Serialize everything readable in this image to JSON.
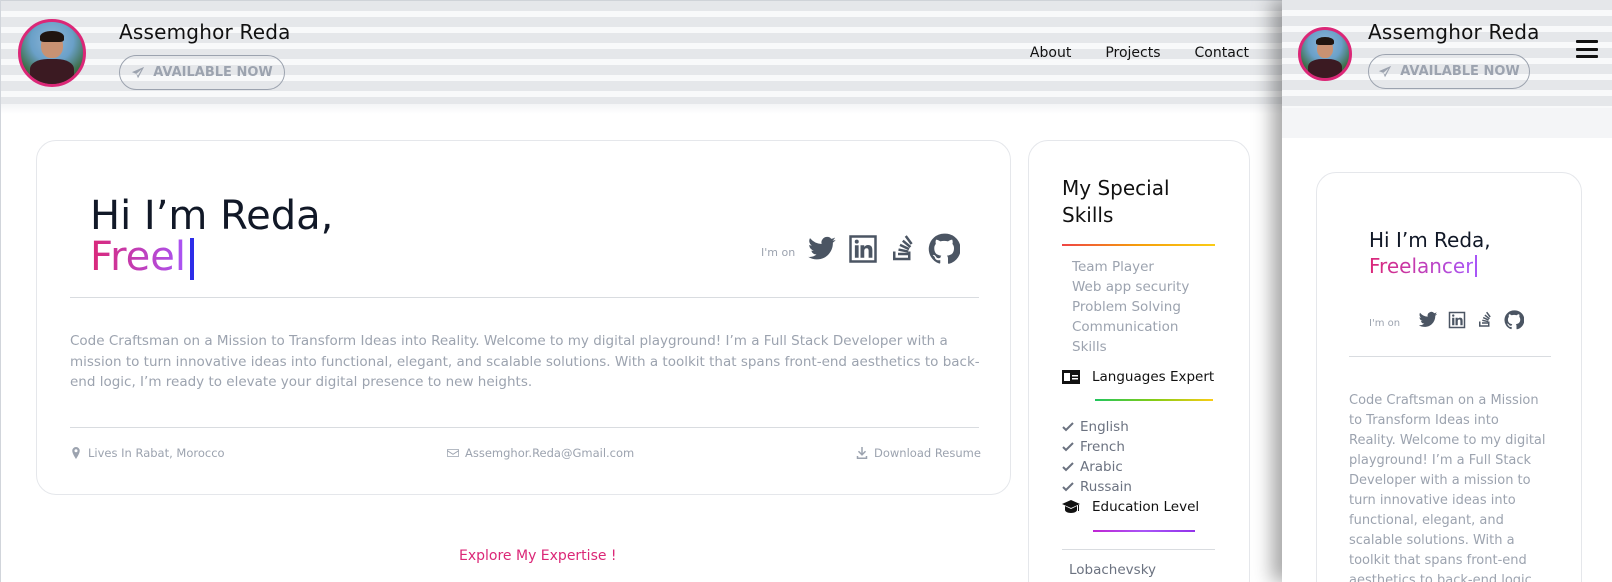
{
  "header": {
    "name": "Assemghor Reda",
    "available_label": "AVAILABLE NOW",
    "nav": [
      "About",
      "Projects",
      "Contact"
    ]
  },
  "hero": {
    "greeting": "Hi I’m Reda,",
    "role_desktop": "Freel",
    "role_mobile": "Freelancer",
    "im_on": "I'm on",
    "social_icons": [
      "twitter-icon",
      "linkedin-icon",
      "stackoverflow-icon",
      "github-icon"
    ],
    "description": "Code Craftsman on a Mission to Transform Ideas into Reality. Welcome to my digital playground! I’m a Full Stack Developer with a mission to turn innovative ideas into functional, elegant, and scalable solutions. With a toolkit that spans front-end aesthetics to back-end logic, I’m ready to elevate your digital presence to new heights.",
    "location": "Lives In Rabat, Morocco",
    "email": "Assemghor.Reda@Gmail.com",
    "resume": "Download Resume"
  },
  "explore": "Explore My Expertise !",
  "skills": {
    "title": "My Special Skills",
    "items": [
      "Team Player",
      "Web app security",
      "Problem Solving",
      "Communication",
      "Skills"
    ],
    "languages_title": "Languages Expert",
    "languages": [
      "English",
      "French",
      "Arabic",
      "Russain"
    ],
    "education_title": "Education Level",
    "education_item": "Lobachevsky"
  },
  "mobile": {
    "description_lines": [
      "Code Craftsman on a Mission",
      "to Transform Ideas into",
      "Reality. Welcome to my digital",
      "playground! I’m a Full Stack",
      "Developer with a mission to",
      "turn innovative ideas into",
      "functional, elegant, and",
      "scalable solutions. With a",
      "toolkit that spans front-end",
      "aesthetics to back-end logic"
    ]
  },
  "colors": {
    "accent": "#db2777",
    "cursor": "#2d2de8",
    "muted": "#9ca3af"
  }
}
